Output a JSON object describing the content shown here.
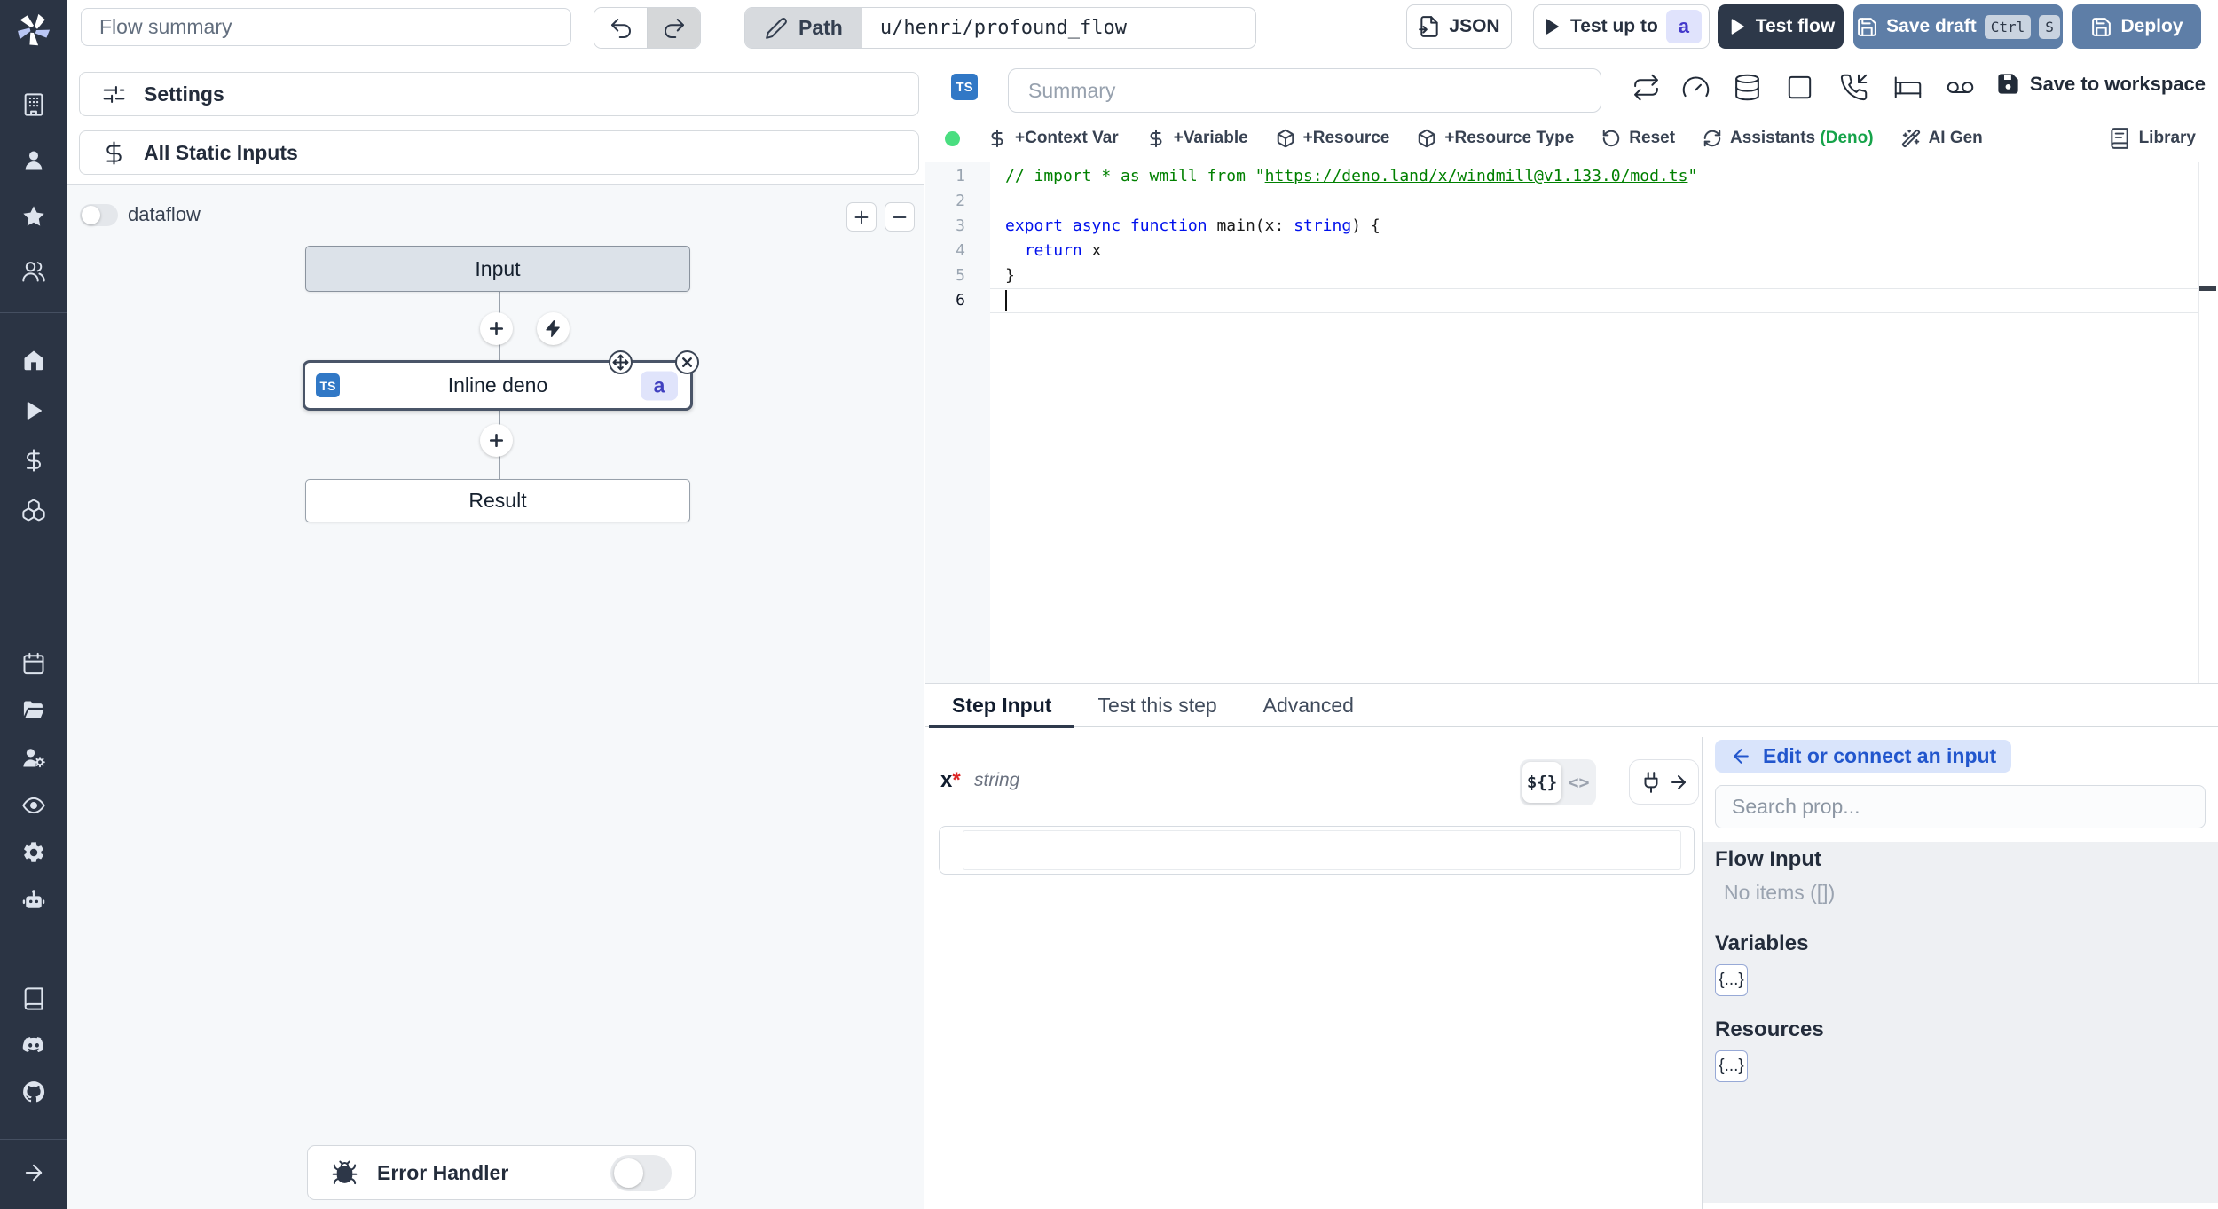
{
  "topbar": {
    "flow_summary_placeholder": "Flow summary",
    "path_label": "Path",
    "path_value": "u/henri/profound_flow",
    "json_label": "JSON",
    "test_up_to_label": "Test up to",
    "test_up_to_badge": "a",
    "test_flow_label": "Test flow",
    "save_draft_label": "Save draft",
    "save_draft_kbd": [
      "Ctrl",
      "S"
    ],
    "deploy_label": "Deploy"
  },
  "sidebar": {
    "items_top": [
      "building",
      "user",
      "star",
      "users"
    ],
    "items_mid": [
      "home",
      "play",
      "dollar",
      "boxes"
    ],
    "items_ops": [
      "calendar",
      "folder-open",
      "users-cog",
      "eye",
      "gear",
      "bot"
    ],
    "items_docs": [
      "book",
      "discord",
      "github"
    ],
    "item_bottom": "arrow-right"
  },
  "left_panel": {
    "settings_label": "Settings",
    "static_inputs_label": "All Static Inputs",
    "dataflow_label": "dataflow",
    "zoom_in_label": "+",
    "zoom_out_label": "−",
    "nodes": {
      "input_label": "Input",
      "step_label": "Inline deno",
      "step_lang_badge": "TS",
      "step_id_badge": "a",
      "result_label": "Result"
    },
    "error_handler_label": "Error Handler"
  },
  "editor": {
    "lang_badge": "TS",
    "summary_placeholder": "Summary",
    "header_icons": [
      "repeat",
      "gauge",
      "database",
      "square",
      "phone-incoming",
      "bed",
      "voicemail"
    ],
    "save_to_workspace_label": "Save to workspace",
    "status_color": "#4ade80",
    "toolbar": [
      {
        "icon": "dollar",
        "label": "+Context Var"
      },
      {
        "icon": "dollar",
        "label": "+Variable"
      },
      {
        "icon": "package",
        "label": "+Resource"
      },
      {
        "icon": "package",
        "label": "+Resource Type"
      },
      {
        "icon": "rotate-ccw",
        "label": "Reset"
      },
      {
        "icon": "refresh-cw",
        "label": "Assistants",
        "suffix": "(Deno)"
      },
      {
        "icon": "wand",
        "label": "AI Gen"
      }
    ],
    "library_label": "Library",
    "code": {
      "line_numbers": [
        1,
        2,
        3,
        4,
        5,
        6
      ],
      "active_line": 6,
      "lines": [
        [
          {
            "t": "// import * as wmill from \"",
            "c": "comment"
          },
          {
            "t": "https://deno.land/x/windmill@v1.133.0/mod.ts",
            "c": "link"
          },
          {
            "t": "\"",
            "c": "comment"
          }
        ],
        [],
        [
          {
            "t": "export",
            "c": "kw"
          },
          {
            "t": " ",
            "c": "plain"
          },
          {
            "t": "async",
            "c": "kw"
          },
          {
            "t": " ",
            "c": "plain"
          },
          {
            "t": "function",
            "c": "kw"
          },
          {
            "t": " main(x: ",
            "c": "plain"
          },
          {
            "t": "string",
            "c": "kw"
          },
          {
            "t": ") {",
            "c": "plain"
          }
        ],
        [
          {
            "t": "  ",
            "c": "plain"
          },
          {
            "t": "return",
            "c": "kw"
          },
          {
            "t": " x",
            "c": "plain"
          }
        ],
        [
          {
            "t": "}",
            "c": "plain"
          }
        ],
        []
      ]
    }
  },
  "bottom": {
    "tabs": [
      "Step Input",
      "Test this step",
      "Advanced"
    ],
    "active_tab": "Step Input",
    "field": {
      "name": "x",
      "required_mark": "*",
      "type": "string"
    },
    "mode_template_label": "${}",
    "mode_code_label": "<>",
    "prop_panel": {
      "back_label": "Edit or connect an input",
      "search_placeholder": "Search prop...",
      "flow_input_title": "Flow Input",
      "flow_input_empty": "No items ([])",
      "variables_title": "Variables",
      "variables_chip": "{...}",
      "resources_title": "Resources",
      "resources_chip": "{...}"
    }
  }
}
